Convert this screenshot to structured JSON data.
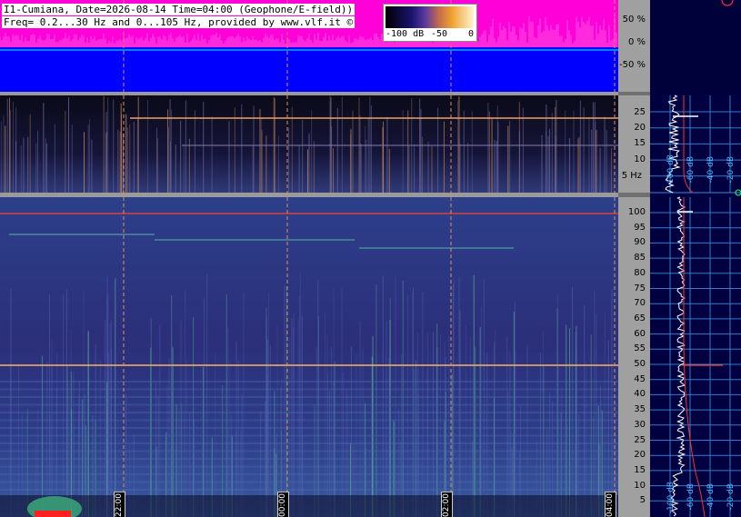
{
  "header": {
    "line1": "I1-Cumiana, Date=2026-08-14 Time=04:00 (Geophone/E-field))",
    "line2": "Freq= 0.2...30 Hz and 0...105 Hz, provided by www.vlf.it ©"
  },
  "colorbar": {
    "labels": [
      "-100 dB",
      "-50",
      "0"
    ]
  },
  "top_panel": {
    "ticks": [
      "50 %",
      "0 %",
      "-50 %"
    ]
  },
  "low_freq_panel": {
    "ticks": [
      "25",
      "20",
      "15",
      "10",
      "5 Hz"
    ]
  },
  "high_freq_panel": {
    "ticks": [
      "100",
      "95",
      "90",
      "85",
      "80",
      "75",
      "70",
      "65",
      "60",
      "55",
      "50",
      "45",
      "40",
      "35",
      "30",
      "25",
      "20",
      "15",
      "10",
      "5"
    ]
  },
  "time_axis": {
    "labels": [
      "22:00",
      "00:00",
      "02:00",
      "04:00"
    ]
  },
  "spectrum_axis": {
    "labels": [
      "-100 dB",
      "-60 dB",
      "-40 dB",
      "-20 dB"
    ]
  },
  "colors": {
    "magenta": "#ff00d8",
    "blue": "#0000ff",
    "spectrogram_bg": "#2a2e78",
    "grid_blue": "#3a8ad8",
    "red_line": "#ff3020",
    "side_bg": "#000040"
  }
}
